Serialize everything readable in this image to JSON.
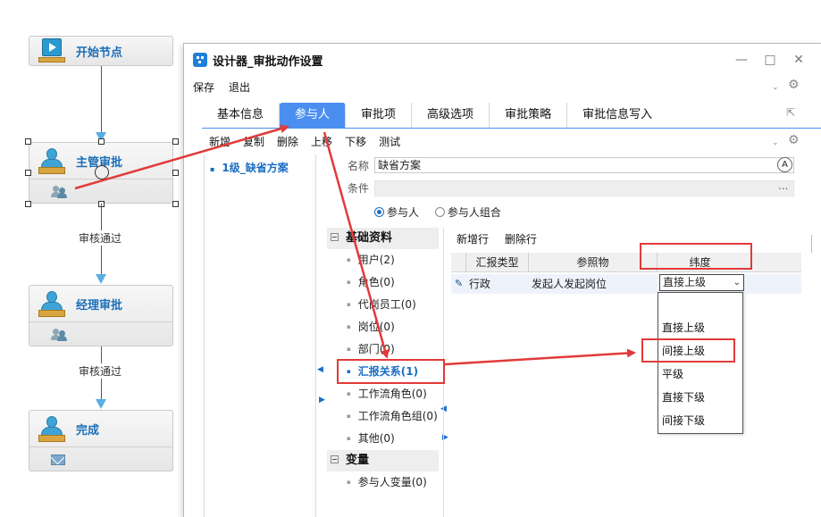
{
  "workflow": {
    "start_node": "开始节点",
    "nodes": [
      {
        "title": "主管审批"
      },
      {
        "title": "经理审批"
      },
      {
        "title": "完成"
      }
    ],
    "edge_labels": [
      "审核通过",
      "审核通过"
    ]
  },
  "dialog": {
    "title": "设计器_审批动作设置",
    "menu": [
      "保存",
      "退出"
    ],
    "tabs": [
      "基本信息",
      "参与人",
      "审批项",
      "高级选项",
      "审批策略",
      "审批信息写入"
    ],
    "active_tab": "参与人",
    "toolbar": [
      "新增",
      "复制",
      "删除",
      "上移",
      "下移",
      "测试"
    ],
    "schemes": [
      "1级_缺省方案"
    ],
    "form": {
      "name_label": "名称",
      "name_value": "缺省方案",
      "condition_label": "条件",
      "condition_button": "...",
      "radio_participant": "参与人",
      "radio_group": "参与人组合"
    },
    "tree": {
      "groups": [
        {
          "label": "基础资料",
          "items": [
            "用户(2)",
            "角色(0)",
            "代岗员工(0)",
            "岗位(0)",
            "部门(0)",
            "汇报关系(1)",
            "工作流角色(0)",
            "工作流角色组(0)",
            "其他(0)"
          ]
        },
        {
          "label": "变量",
          "items": [
            "参与人变量(0)"
          ]
        }
      ],
      "selected": "汇报关系(1)"
    },
    "grid": {
      "tools": [
        "新增行",
        "删除行"
      ],
      "columns": [
        "汇报类型",
        "参照物",
        "纬度"
      ],
      "rows": [
        {
          "type": "行政",
          "ref": "发起人发起岗位",
          "dimension": "直接上级"
        }
      ],
      "dropdown_options": [
        "",
        "直接上级",
        "间接上级",
        "平级",
        "直接下级",
        "间接下级"
      ]
    }
  },
  "colors": {
    "accent": "#4a8ff0",
    "annotation": "#e23a3a",
    "link": "#1a6dc4"
  }
}
